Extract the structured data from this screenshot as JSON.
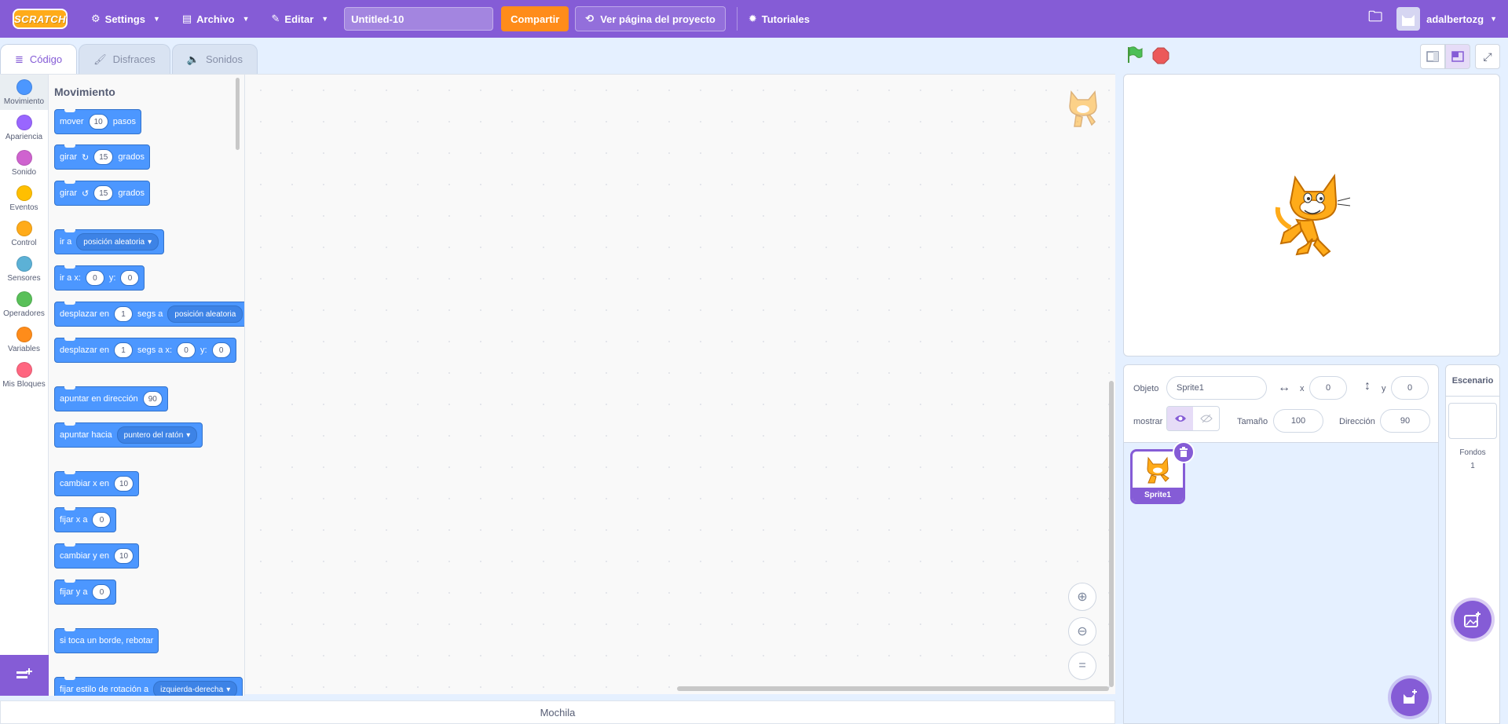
{
  "menubar": {
    "logo": "SCRATCH",
    "settings": "Settings",
    "file": "Archivo",
    "edit": "Editar",
    "project_title": "Untitled-10",
    "share": "Compartir",
    "see_project": "Ver página del proyecto",
    "tutorials": "Tutoriales",
    "username": "adalbertozg"
  },
  "tabs": {
    "code": "Código",
    "costumes": "Disfraces",
    "sounds": "Sonidos"
  },
  "categories": [
    {
      "label": "Movimiento",
      "color": "#4c97ff"
    },
    {
      "label": "Apariencia",
      "color": "#9966ff"
    },
    {
      "label": "Sonido",
      "color": "#cf63cf"
    },
    {
      "label": "Eventos",
      "color": "#ffbf00"
    },
    {
      "label": "Control",
      "color": "#ffab19"
    },
    {
      "label": "Sensores",
      "color": "#5cb1d6"
    },
    {
      "label": "Operadores",
      "color": "#59c059"
    },
    {
      "label": "Variables",
      "color": "#ff8c1a"
    },
    {
      "label": "Mis Bloques",
      "color": "#ff6680"
    }
  ],
  "palette": {
    "title": "Movimiento",
    "blocks": {
      "move": {
        "a": "mover",
        "v": "10",
        "b": "pasos"
      },
      "turn_right": {
        "a": "girar",
        "v": "15",
        "b": "grados"
      },
      "turn_left": {
        "a": "girar",
        "v": "15",
        "b": "grados"
      },
      "goto": {
        "a": "ir a",
        "d": "posición aleatoria"
      },
      "goto_xy": {
        "a": "ir a x:",
        "x": "0",
        "b": "y:",
        "y": "0"
      },
      "glide_to": {
        "a": "desplazar en",
        "v": "1",
        "b": "segs a",
        "d": "posición aleatoria"
      },
      "glide_xy": {
        "a": "desplazar en",
        "v": "1",
        "b": "segs a x:",
        "x": "0",
        "c": "y:",
        "y": "0"
      },
      "point_dir": {
        "a": "apuntar en dirección",
        "v": "90"
      },
      "point_towards": {
        "a": "apuntar hacia",
        "d": "puntero del ratón"
      },
      "change_x": {
        "a": "cambiar x en",
        "v": "10"
      },
      "set_x": {
        "a": "fijar x a",
        "v": "0"
      },
      "change_y": {
        "a": "cambiar y en",
        "v": "10"
      },
      "set_y": {
        "a": "fijar y a",
        "v": "0"
      },
      "bounce": {
        "a": "si toca un borde, rebotar"
      },
      "rotation": {
        "a": "fijar estilo de rotación a",
        "d": "izquierda-derecha"
      }
    }
  },
  "backpack": "Mochila",
  "sprite_info": {
    "sprite_label": "Objeto",
    "sprite_name": "Sprite1",
    "x_label": "x",
    "x": "0",
    "y_label": "y",
    "y": "0",
    "show_label": "mostrar",
    "size_label": "Tamaño",
    "size": "100",
    "direction_label": "Dirección",
    "direction": "90"
  },
  "sprites": [
    {
      "name": "Sprite1"
    }
  ],
  "stage_panel": {
    "title": "Escenario",
    "backdrops_label": "Fondos",
    "backdrops_count": "1"
  }
}
